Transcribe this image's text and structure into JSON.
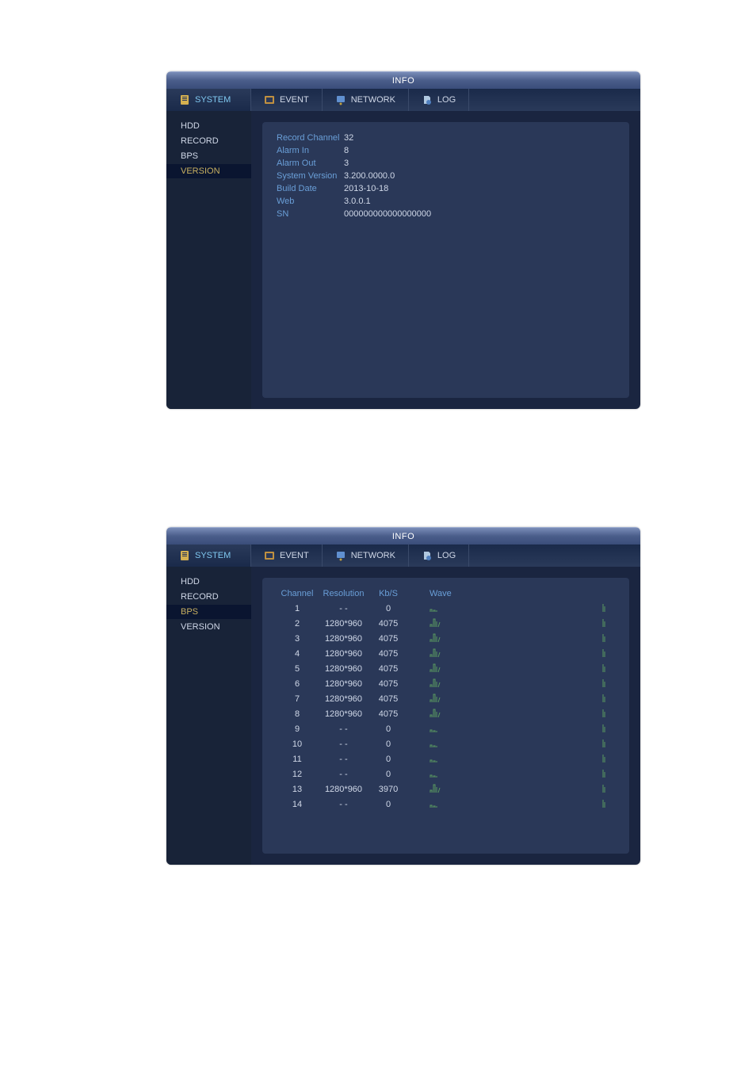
{
  "window1": {
    "title": "INFO",
    "tabs": {
      "system": "SYSTEM",
      "event": "EVENT",
      "network": "NETWORK",
      "log": "LOG"
    },
    "sidebar": {
      "hdd": "HDD",
      "record": "RECORD",
      "bps": "BPS",
      "version": "VERSION"
    },
    "info": {
      "record_channel_label": "Record Channel",
      "record_channel_value": "32",
      "alarm_in_label": "Alarm In",
      "alarm_in_value": "8",
      "alarm_out_label": "Alarm Out",
      "alarm_out_value": "3",
      "system_version_label": "System Version",
      "system_version_value": "3.200.0000.0",
      "build_date_label": "Build Date",
      "build_date_value": "2013-10-18",
      "web_label": "Web",
      "web_value": "3.0.0.1",
      "sn_label": "SN",
      "sn_value": "000000000000000000"
    }
  },
  "window2": {
    "title": "INFO",
    "tabs": {
      "system": "SYSTEM",
      "event": "EVENT",
      "network": "NETWORK",
      "log": "LOG"
    },
    "sidebar": {
      "hdd": "HDD",
      "record": "RECORD",
      "bps": "BPS",
      "version": "VERSION"
    },
    "headers": {
      "channel": "Channel",
      "resolution": "Resolution",
      "kbs": "Kb/S",
      "wave": "Wave"
    },
    "rows": [
      {
        "ch": "1",
        "res": "- -",
        "kbs": "0",
        "wave": "low"
      },
      {
        "ch": "2",
        "res": "1280*960",
        "kbs": "4075",
        "wave": "high"
      },
      {
        "ch": "3",
        "res": "1280*960",
        "kbs": "4075",
        "wave": "high"
      },
      {
        "ch": "4",
        "res": "1280*960",
        "kbs": "4075",
        "wave": "high"
      },
      {
        "ch": "5",
        "res": "1280*960",
        "kbs": "4075",
        "wave": "high"
      },
      {
        "ch": "6",
        "res": "1280*960",
        "kbs": "4075",
        "wave": "high"
      },
      {
        "ch": "7",
        "res": "1280*960",
        "kbs": "4075",
        "wave": "high"
      },
      {
        "ch": "8",
        "res": "1280*960",
        "kbs": "4075",
        "wave": "high"
      },
      {
        "ch": "9",
        "res": "- -",
        "kbs": "0",
        "wave": "low"
      },
      {
        "ch": "10",
        "res": "- -",
        "kbs": "0",
        "wave": "low"
      },
      {
        "ch": "11",
        "res": "- -",
        "kbs": "0",
        "wave": "low"
      },
      {
        "ch": "12",
        "res": "- -",
        "kbs": "0",
        "wave": "low"
      },
      {
        "ch": "13",
        "res": "1280*960",
        "kbs": "3970",
        "wave": "high"
      },
      {
        "ch": "14",
        "res": "- -",
        "kbs": "0",
        "wave": "low"
      }
    ]
  },
  "chart_data": {
    "type": "table",
    "title": "BPS (bitrate per channel)",
    "columns": [
      "Channel",
      "Resolution",
      "Kb/S"
    ],
    "rows": [
      [
        1,
        null,
        0
      ],
      [
        2,
        "1280*960",
        4075
      ],
      [
        3,
        "1280*960",
        4075
      ],
      [
        4,
        "1280*960",
        4075
      ],
      [
        5,
        "1280*960",
        4075
      ],
      [
        6,
        "1280*960",
        4075
      ],
      [
        7,
        "1280*960",
        4075
      ],
      [
        8,
        "1280*960",
        4075
      ],
      [
        9,
        null,
        0
      ],
      [
        10,
        null,
        0
      ],
      [
        11,
        null,
        0
      ],
      [
        12,
        null,
        0
      ],
      [
        13,
        "1280*960",
        3970
      ],
      [
        14,
        null,
        0
      ]
    ]
  }
}
